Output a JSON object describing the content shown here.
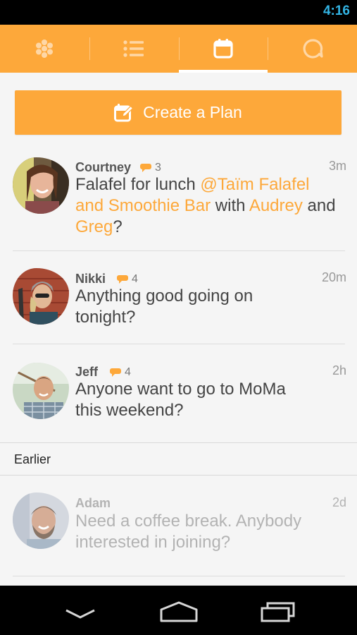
{
  "status_bar": {
    "time": "4:16"
  },
  "tabs": [
    {
      "name": "hub",
      "icon": "flower-dots-icon",
      "active": false
    },
    {
      "name": "list",
      "icon": "list-icon",
      "active": false
    },
    {
      "name": "plans",
      "icon": "calendar-icon",
      "active": true
    },
    {
      "name": "chat",
      "icon": "chat-bubble-icon",
      "active": false
    }
  ],
  "create_plan": {
    "label": "Create a Plan",
    "icon": "edit-calendar-icon"
  },
  "feed": [
    {
      "name": "Courtney",
      "comments": "3",
      "time": "3m",
      "message_parts": [
        "Falafel for lunch ",
        "@Taïm Falafel and Smoothie Bar",
        " with ",
        "Audrey",
        " and ",
        "Greg",
        "?"
      ]
    },
    {
      "name": "Nikki",
      "comments": "4",
      "time": "20m",
      "message": "Anything good going on tonight?"
    },
    {
      "name": "Jeff",
      "comments": "4",
      "time": "2h",
      "message": "Anyone want to go to MoMa this weekend?"
    }
  ],
  "section_earlier": "Earlier",
  "earlier": [
    {
      "name": "Adam",
      "time": "2d",
      "message": "Need a coffee break. Anybody interested in joining?"
    }
  ],
  "colors": {
    "accent": "#fda83a",
    "status_time": "#33b5e5"
  }
}
